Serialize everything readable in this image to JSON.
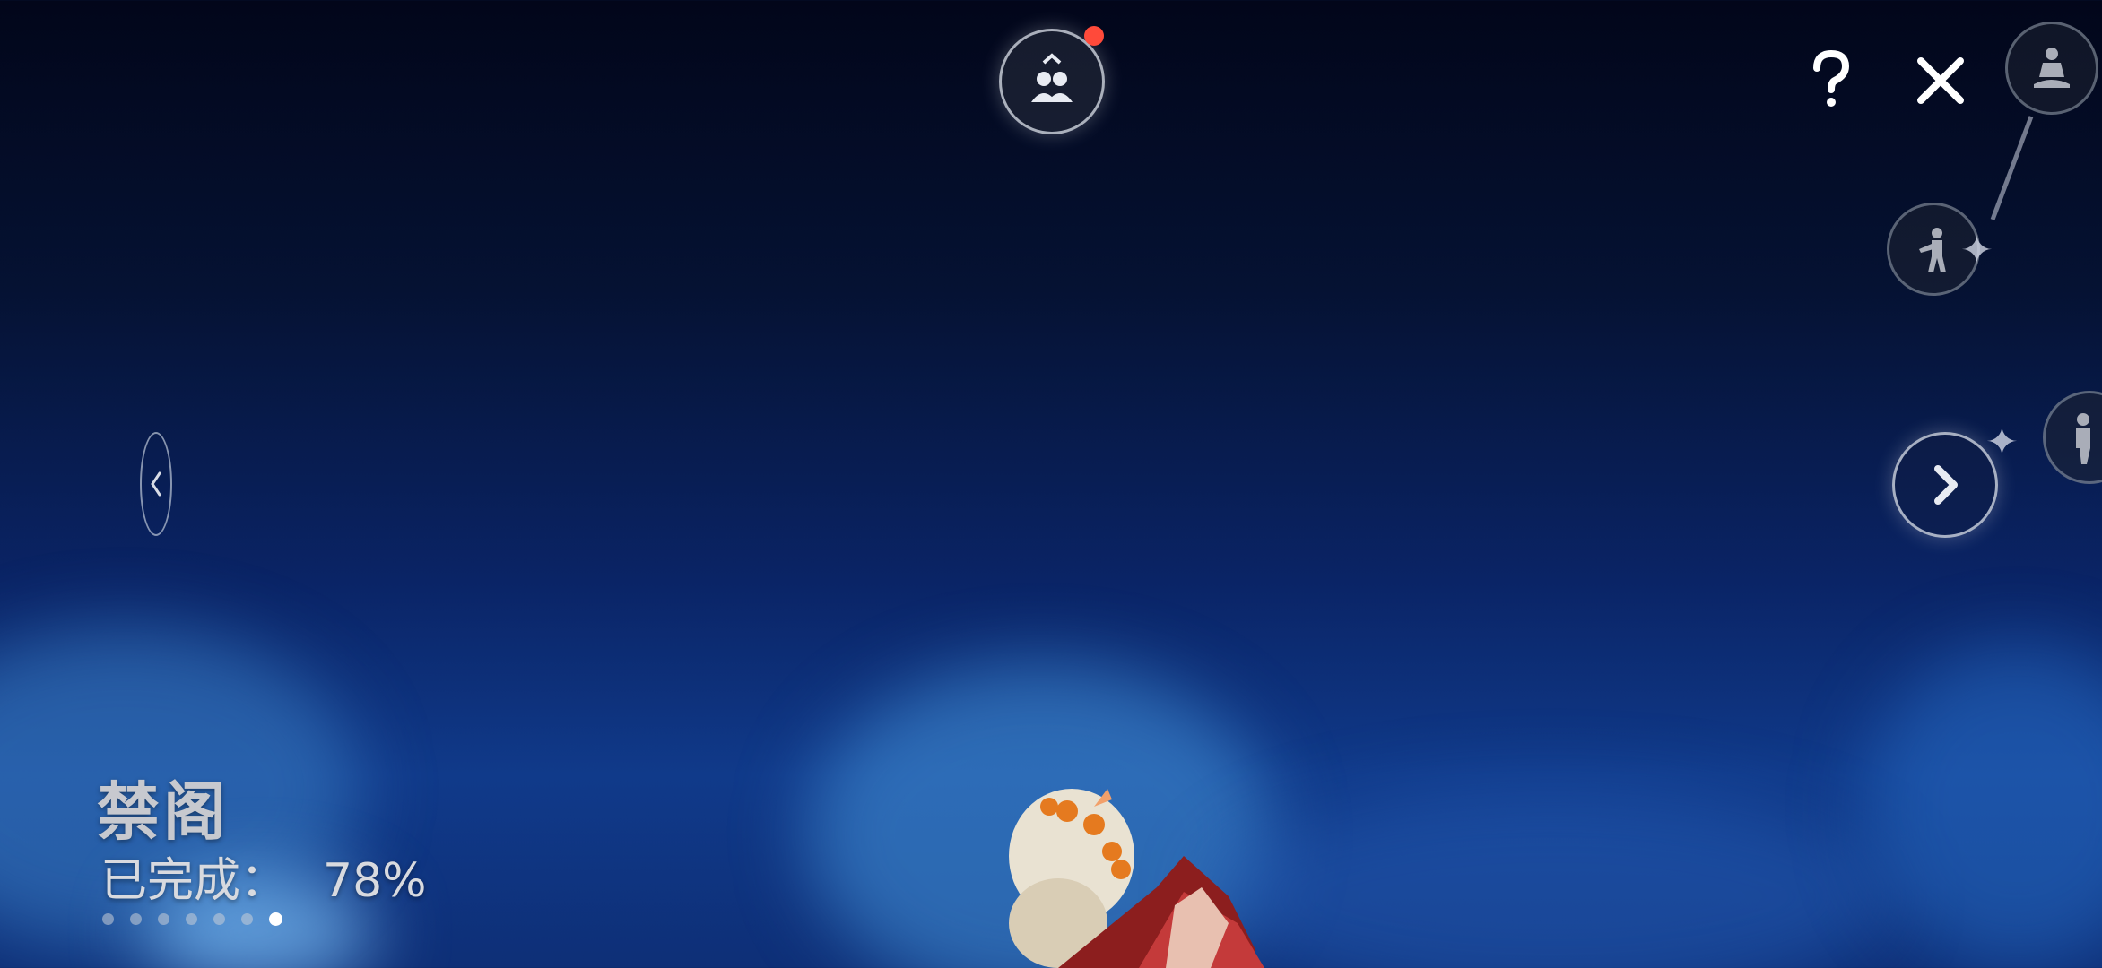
{
  "area": {
    "name": "禁阁",
    "progress_label": "已完成：",
    "progress_value": "78%"
  },
  "pager": {
    "count": 7,
    "active_index": 6
  },
  "icons": {
    "friends": "friends-icon",
    "help": "question-icon",
    "close": "close-icon",
    "next": "chevron-right-icon",
    "prev": "chevron-left-icon"
  },
  "colors": {
    "notification": "#ff4a3a",
    "sky_top": "#02061a",
    "sky_bottom": "#103a8a"
  }
}
